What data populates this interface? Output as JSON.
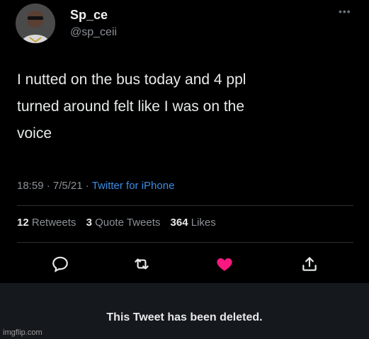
{
  "author": {
    "name": "Sp_ce",
    "handle": "@sp_ceii"
  },
  "tweet": {
    "text_lines": [
      "I nutted on the bus today and 4 ppl",
      "turned around felt like I was on the",
      "voice"
    ],
    "time": "18:59",
    "date": "7/5/21",
    "source": "Twitter for iPhone"
  },
  "stats": {
    "retweets_count": "12",
    "retweets_label": "Retweets",
    "quotes_count": "3",
    "quotes_label": "Quote Tweets",
    "likes_count": "364",
    "likes_label": "Likes"
  },
  "actions": {
    "reply_icon": "speech-bubble-icon",
    "retweet_icon": "retweet-arrows-icon",
    "like_icon": "heart-icon",
    "share_icon": "share-upload-icon",
    "like_color": "#f91880"
  },
  "deleted_notice": "This Tweet has been deleted.",
  "watermark": "imgflip.com",
  "colors": {
    "background": "#000000",
    "text": "#e7e9ea",
    "muted": "#8b9096",
    "link": "#3a8ee6",
    "banner": "#15191d"
  }
}
